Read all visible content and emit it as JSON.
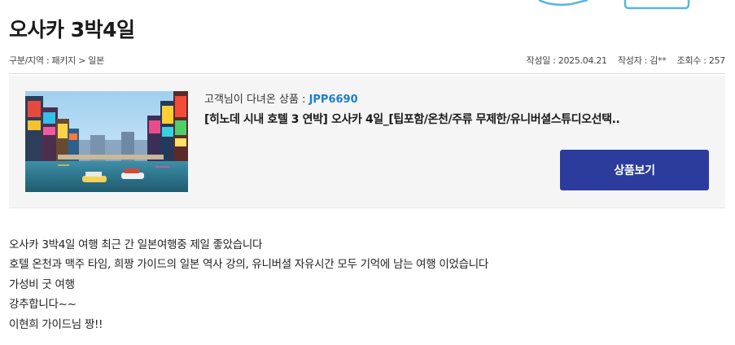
{
  "post": {
    "title": "오사카 3박4일",
    "breadcrumb": "구분/지역 : 패키지 > 일본",
    "date": "작성일 : 2025.04.21",
    "author": "작성자 : 김**",
    "views": "조회수 : 257"
  },
  "product": {
    "label_prefix": "고객님이 다녀온 상품 : ",
    "code": "JPP6690",
    "name": "[히노데 시내 호텔 3 연박] 오사카 4일_[팁포함/온천/주류 무제한/유니버셜스튜디오선택..",
    "view_button": "상품보기"
  },
  "content": {
    "lines": [
      "오사카 3박4일 여행 최근 간 일본여행중 제일 좋았습니다",
      "호텔 온천과 맥주 타임, 희짱 가이드의 일본 역사 강의, 유니버셜 자유시간 모두 기억에 남는 여행 이었습니다",
      "가성비 굿 여행",
      "강추합니다~~",
      "이현희 가이드님 짱!!"
    ]
  },
  "colors": {
    "accent": "#2b3c9c",
    "code": "#1e7dd6",
    "panel": "#f5f5f5"
  }
}
